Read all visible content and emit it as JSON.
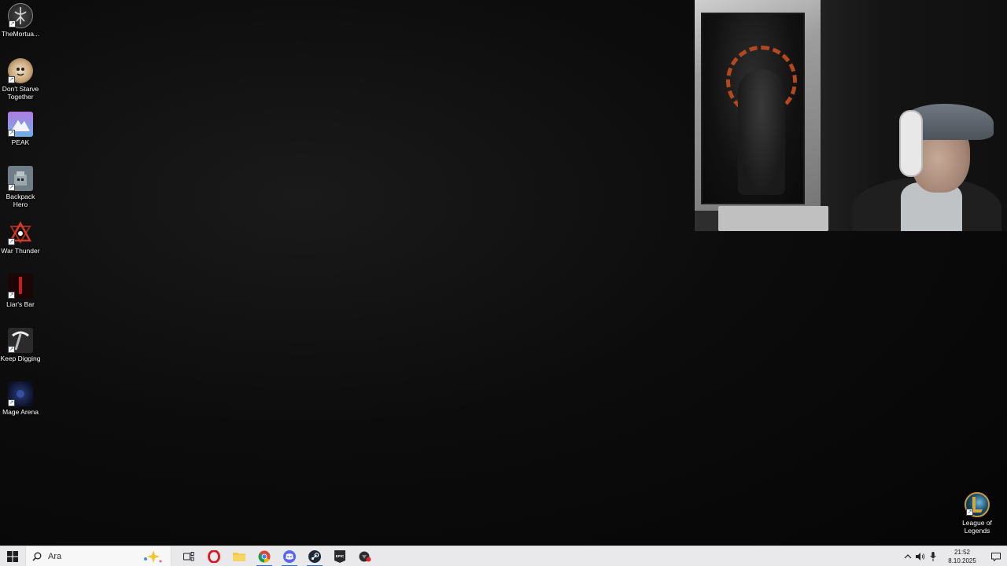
{
  "desktop": {
    "icons": [
      {
        "label": "TheMortua...",
        "icon": "mortuary-assistant-icon"
      },
      {
        "label": "Don't Starve Together",
        "icon": "dont-starve-together-icon"
      },
      {
        "label": "PEAK",
        "icon": "peak-mountain-icon"
      },
      {
        "label": "Backpack Hero",
        "icon": "backpack-hero-icon"
      },
      {
        "label": "War Thunder",
        "icon": "war-thunder-icon"
      },
      {
        "label": "Liar's Bar",
        "icon": "liars-bar-icon"
      },
      {
        "label": "Keep Digging",
        "icon": "pickaxe-icon"
      },
      {
        "label": "Mage Arena",
        "icon": "mage-arena-icon"
      }
    ],
    "right_icon": {
      "label": "League of Legends",
      "icon": "league-of-legends-icon"
    }
  },
  "webcam": {
    "description_icon": "webcam-overlay"
  },
  "taskbar": {
    "search_placeholder": "Ara",
    "apps": [
      {
        "name": "task-view",
        "icon": "task-view-icon"
      },
      {
        "name": "opera",
        "icon": "opera-icon"
      },
      {
        "name": "file-explorer",
        "icon": "folder-icon"
      },
      {
        "name": "chrome",
        "icon": "chrome-icon",
        "active": true
      },
      {
        "name": "discord",
        "icon": "discord-icon",
        "active": true
      },
      {
        "name": "steam",
        "icon": "steam-icon",
        "active": true
      },
      {
        "name": "epic-games",
        "icon": "epic-games-icon"
      },
      {
        "name": "game-app",
        "icon": "red-badge-app-icon"
      }
    ],
    "clock": {
      "time": "21:52",
      "date": "8.10.2025"
    }
  },
  "colors": {
    "taskbar_bg": "#e9e9eb",
    "accent": "#2a72c8"
  }
}
